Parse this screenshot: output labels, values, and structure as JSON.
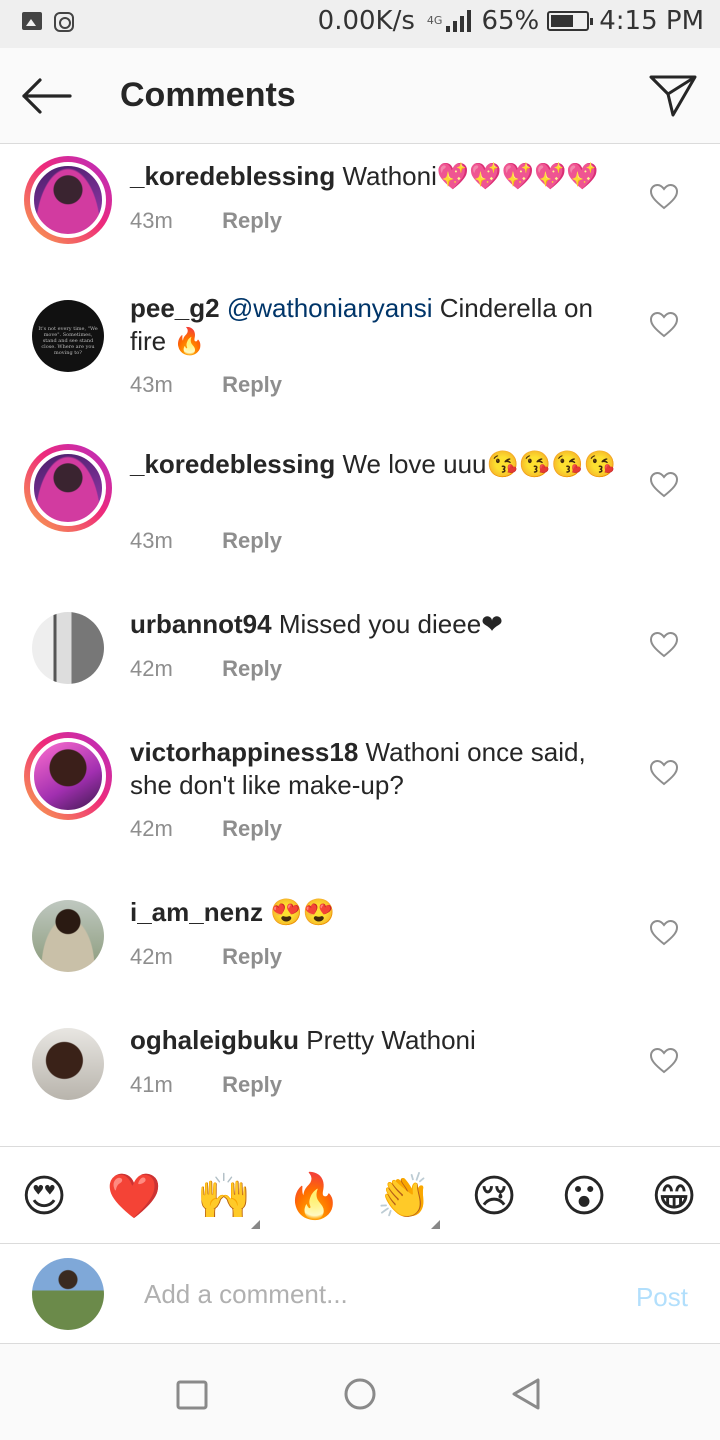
{
  "status_bar": {
    "speed": "0.00K/s",
    "network": "4G",
    "battery_percent": "65%",
    "battery_level": 0.65,
    "time": "4:15 PM"
  },
  "header": {
    "title": "Comments"
  },
  "comments": [
    {
      "username": "_koredeblessing",
      "text": "Wathoni💖💖💖💖💖",
      "time": "43m",
      "reply": "Reply",
      "avatar_style": "purple",
      "has_story": true
    },
    {
      "username": "pee_g2",
      "mention": "@wathonianyansi",
      "text": "Cinderella on fire 🔥",
      "time": "43m",
      "reply": "Reply",
      "avatar_style": "black",
      "avatar_text": "It's not every time, \"We move\". Sometimes, stand and see stand close. Where are you moving to?",
      "has_story": false
    },
    {
      "username": "_koredeblessing",
      "text": "We love uuu😘😘😘😘",
      "time": "43m",
      "reply": "Reply",
      "avatar_style": "purple",
      "has_story": true
    },
    {
      "username": "urbannot94",
      "text": "Missed you dieee❤",
      "time": "42m",
      "reply": "Reply",
      "avatar_style": "gray",
      "has_story": false
    },
    {
      "username": "victorhappiness18",
      "text": "Wathoni once said, she don't like make-up?",
      "time": "42m",
      "reply": "Reply",
      "avatar_style": "pink",
      "has_story": true
    },
    {
      "username": "i_am_nenz",
      "text": "😍😍",
      "time": "42m",
      "reply": "Reply",
      "avatar_style": "leopard",
      "has_story": false
    },
    {
      "username": "oghaleigbuku",
      "text": "Pretty Wathoni",
      "time": "41m",
      "reply": "Reply",
      "avatar_style": "selfie",
      "has_story": false
    }
  ],
  "emoji_bar": [
    {
      "emoji": "😍",
      "name": "heart-eyes"
    },
    {
      "emoji": "❤️",
      "name": "red-heart"
    },
    {
      "emoji": "🙌",
      "name": "raising-hands"
    },
    {
      "emoji": "🔥",
      "name": "fire"
    },
    {
      "emoji": "👏",
      "name": "clapping-hands"
    },
    {
      "emoji": "😢",
      "name": "crying-face"
    },
    {
      "emoji": "😮",
      "name": "surprised-face"
    },
    {
      "emoji": "😁",
      "name": "grinning-face"
    }
  ],
  "composer": {
    "placeholder": "Add a comment...",
    "value": "",
    "post_label": "Post"
  },
  "colors": {
    "accent_link": "#003569",
    "post_disabled": "#b2dffc",
    "meta_gray": "#8e8e8e"
  }
}
